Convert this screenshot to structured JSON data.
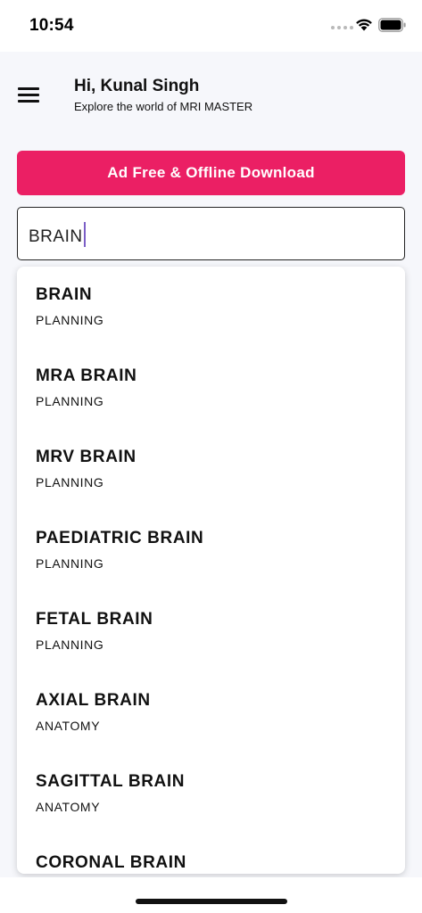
{
  "status_bar": {
    "time": "10:54"
  },
  "header": {
    "greeting": "Hi, Kunal Singh",
    "subtitle": "Explore the world of MRI MASTER"
  },
  "ad_button": {
    "label": "Ad Free & Offline Download"
  },
  "search": {
    "value": "BRAIN"
  },
  "results": [
    {
      "title": "BRAIN",
      "category": "PLANNING"
    },
    {
      "title": "MRA BRAIN",
      "category": "PLANNING"
    },
    {
      "title": "MRV BRAIN",
      "category": "PLANNING"
    },
    {
      "title": "PAEDIATRIC BRAIN",
      "category": "PLANNING"
    },
    {
      "title": "FETAL BRAIN",
      "category": "PLANNING"
    },
    {
      "title": "AXIAL BRAIN",
      "category": "ANATOMY"
    },
    {
      "title": "SAGITTAL BRAIN",
      "category": "ANATOMY"
    },
    {
      "title": "CORONAL BRAIN",
      "category": ""
    }
  ],
  "colors": {
    "accent": "#eb1f64",
    "caret": "#7b5ec6",
    "background": "#f6f7fb"
  },
  "icons": {
    "menu": "hamburger-menu-icon",
    "wifi": "wifi-icon",
    "battery": "battery-icon"
  }
}
